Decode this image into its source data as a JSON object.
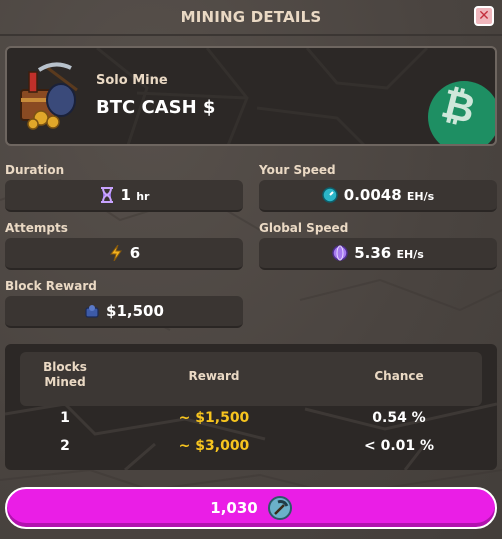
{
  "header": {
    "title": "MINING DETAILS",
    "close_icon": "close-icon"
  },
  "hero": {
    "subtitle": "Solo Mine",
    "coin_name": "BTC CASH $",
    "coin_logo_glyph": "₿",
    "logo_color": "#1e8f63"
  },
  "stats": {
    "duration": {
      "label": "Duration",
      "value": "1",
      "unit": "hr",
      "icon": "hourglass-icon"
    },
    "attempts": {
      "label": "Attempts",
      "value": "6",
      "icon": "lightning-icon"
    },
    "block_reward": {
      "label": "Block Reward",
      "value": "$1,500",
      "icon": "coin-stack-icon"
    },
    "your_speed": {
      "label": "Your Speed",
      "value": "0.0048",
      "unit": "EH/s",
      "icon": "speed-gauge-icon"
    },
    "global_speed": {
      "label": "Global Speed",
      "value": "5.36",
      "unit": "EH/s",
      "icon": "globe-icon"
    }
  },
  "table": {
    "headers": {
      "blocks": "Blocks\nMined",
      "reward": "Reward",
      "chance": "Chance"
    },
    "rows": [
      {
        "blocks": "1",
        "reward": "~ $1,500",
        "chance": "0.54 %"
      },
      {
        "blocks": "2",
        "reward": "~ $3,000",
        "chance": "< 0.01 %"
      }
    ]
  },
  "action": {
    "cost": "1,030",
    "icon": "pickaxe-icon",
    "color": "#ea1ee6"
  }
}
